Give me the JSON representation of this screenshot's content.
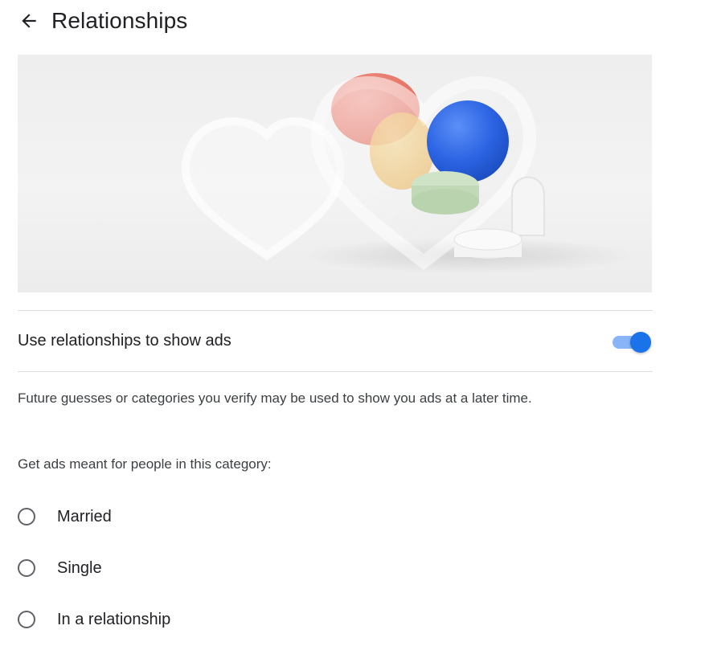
{
  "header": {
    "title": "Relationships",
    "back_icon": "arrow-left-icon"
  },
  "hero": {
    "image": "glass-heart-illustration"
  },
  "ad_toggle": {
    "label": "Use relationships to show ads",
    "enabled": true,
    "accent_color": "#1a73e8",
    "track_color": "#8ab4f8"
  },
  "info": {
    "text": "Future guesses or categories you verify may be used to show you ads at a later time."
  },
  "category": {
    "prompt": "Get ads meant for people in this category:",
    "options": [
      {
        "label": "Married",
        "selected": false
      },
      {
        "label": "Single",
        "selected": false
      },
      {
        "label": "In a relationship",
        "selected": false
      }
    ]
  }
}
